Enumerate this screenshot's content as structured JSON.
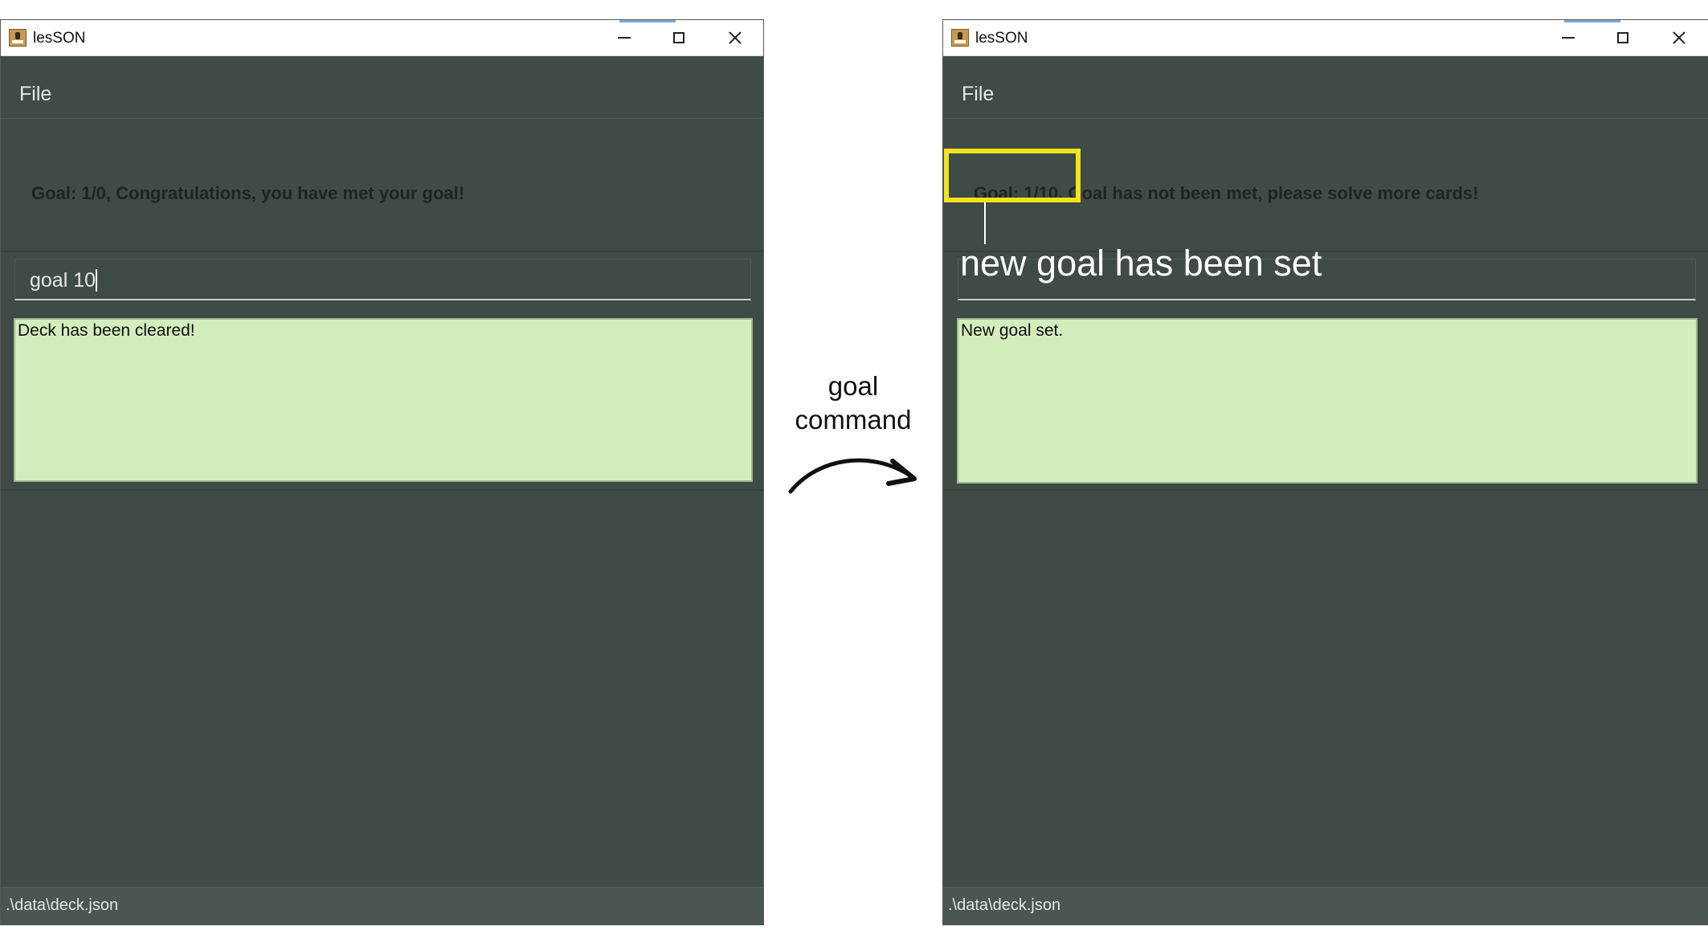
{
  "annotation": {
    "arrow_label": "goal\ncommand",
    "callout_label": "new goal has been set"
  },
  "windows": [
    {
      "title": "lesSON",
      "menu": {
        "file": "File"
      },
      "goal_text": "Goal: 1/0, Congratulations, you have met your goal!",
      "command_input": {
        "value": "goal 10"
      },
      "result_text": "Deck has been cleared!",
      "status_path": ".\\data\\deck.json"
    },
    {
      "title": "lesSON",
      "menu": {
        "file": "File"
      },
      "goal_text": "Goal: 1/10, Goal has not been met, please solve more cards!",
      "command_input": {
        "value": ""
      },
      "result_text": "New goal set.",
      "status_path": ".\\data\\deck.json"
    }
  ],
  "colors": {
    "window_bg": "#3f4b45",
    "result_bg": "#d3edbd",
    "highlight": "#f2e31c"
  }
}
